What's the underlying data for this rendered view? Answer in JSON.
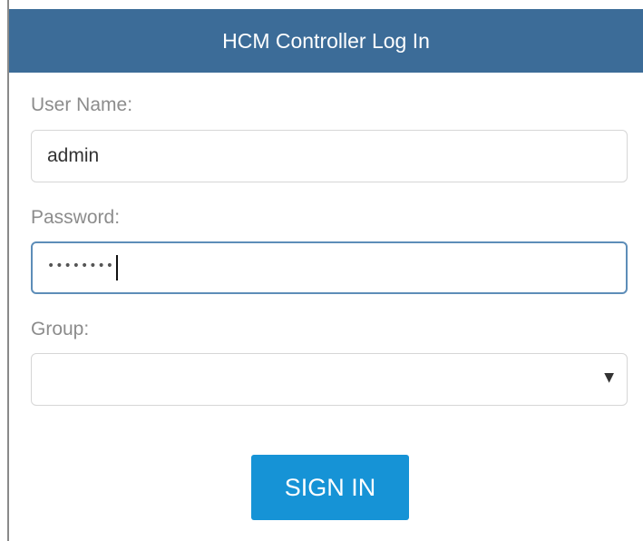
{
  "dialog": {
    "title": "HCM Controller Log In"
  },
  "form": {
    "username_label": "User Name:",
    "username_value": "admin",
    "password_label": "Password:",
    "password_mask": "••••••••",
    "group_label": "Group:",
    "group_value": "",
    "group_arrow": "▼"
  },
  "actions": {
    "signin_label": "SIGN IN"
  },
  "colors": {
    "header_bg": "#3c6c98",
    "button_bg": "#1693d6",
    "focus_border": "#5d8db8"
  }
}
